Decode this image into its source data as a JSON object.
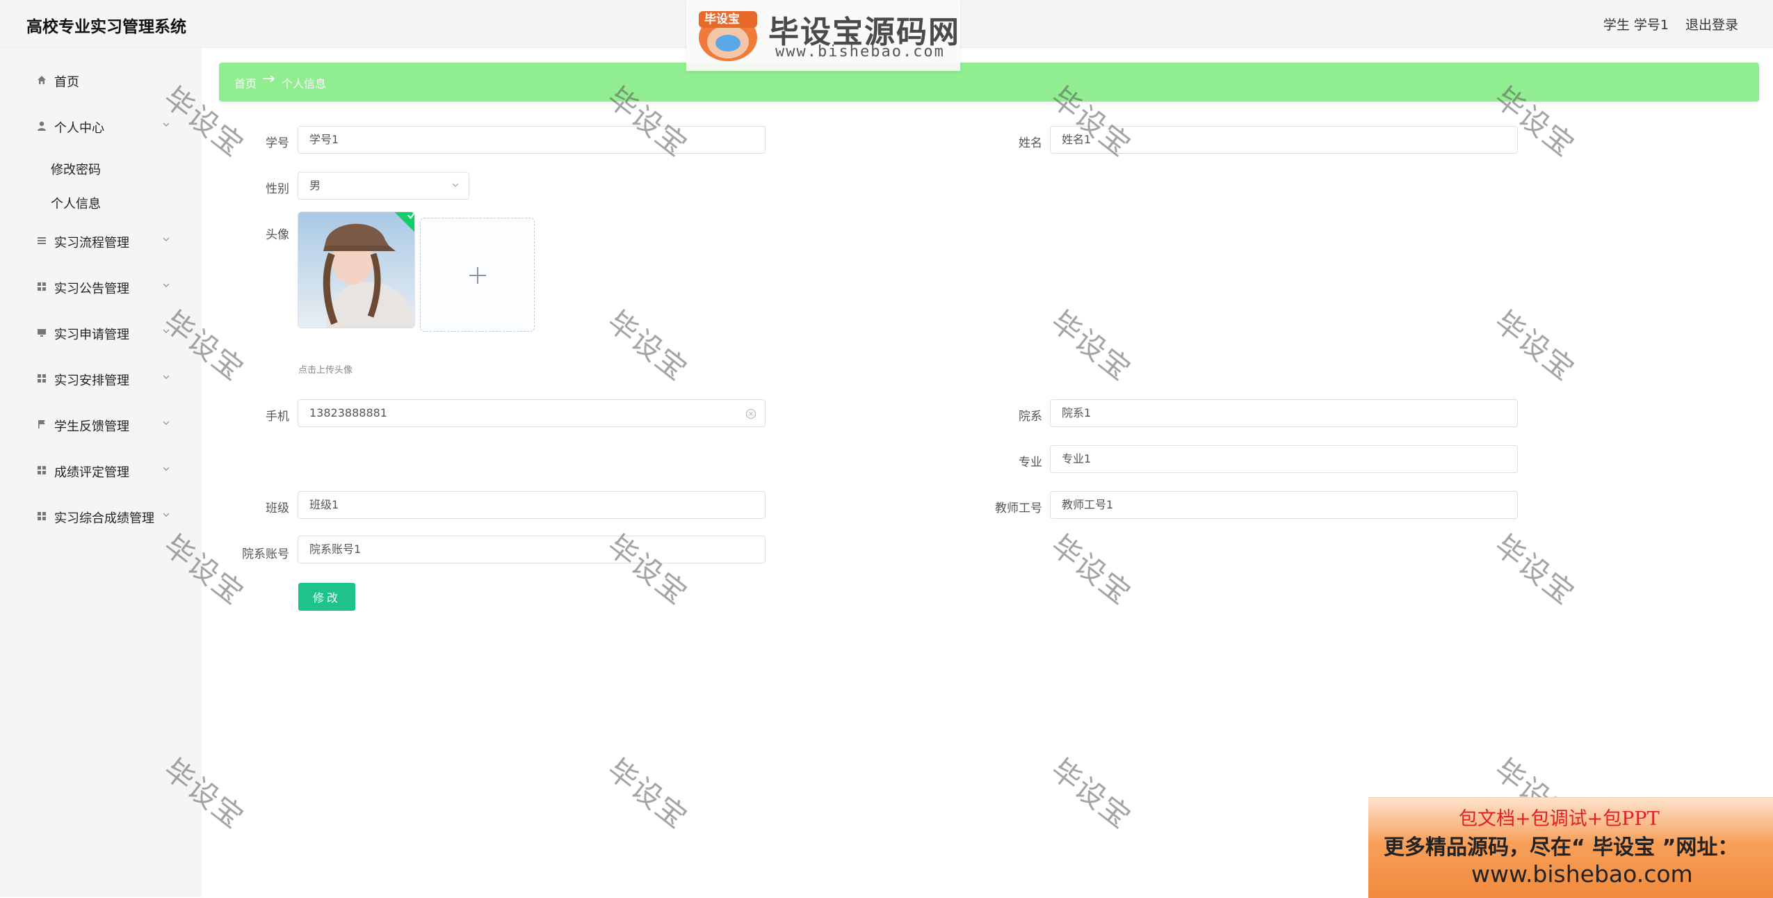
{
  "header": {
    "title": "高校专业实习管理系统",
    "user_label": "学生 学号1",
    "logout_label": "退出登录"
  },
  "watermark_logo": {
    "badge": "毕设宝",
    "title": "毕设宝源码网",
    "url": "www.bishebao.com"
  },
  "watermark_text": "毕设宝",
  "sidebar": {
    "items": [
      {
        "label": "首页",
        "icon": "home-icon"
      },
      {
        "label": "个人中心",
        "icon": "user-icon"
      },
      {
        "label": "实习流程管理",
        "icon": "list-icon"
      },
      {
        "label": "实习公告管理",
        "icon": "grid-icon"
      },
      {
        "label": "实习申请管理",
        "icon": "monitor-icon"
      },
      {
        "label": "实习安排管理",
        "icon": "grid-icon"
      },
      {
        "label": "学生反馈管理",
        "icon": "flag-icon"
      },
      {
        "label": "成绩评定管理",
        "icon": "grid-icon"
      },
      {
        "label": "实习综合成绩管理",
        "icon": "grid-icon"
      }
    ],
    "sub_items": [
      "修改密码",
      "个人信息"
    ]
  },
  "breadcrumb": {
    "home": "首页",
    "separator": "→",
    "current": "个人信息"
  },
  "form": {
    "student_no": {
      "label": "学号",
      "value": "学号1"
    },
    "name": {
      "label": "姓名",
      "value": "姓名1"
    },
    "gender": {
      "label": "性别",
      "value": "男"
    },
    "avatar": {
      "label": "头像",
      "tip": "点击上传头像"
    },
    "phone": {
      "label": "手机",
      "value": "13823888881"
    },
    "department": {
      "label": "院系",
      "value": "院系1"
    },
    "major": {
      "label": "专业",
      "value": "专业1"
    },
    "class": {
      "label": "班级",
      "value": "班级1"
    },
    "teacher_no": {
      "label": "教师工号",
      "value": "教师工号1"
    },
    "dept_account": {
      "label": "院系账号",
      "value": "院系账号1"
    },
    "submit_label": "修改"
  },
  "promo": {
    "line1": "包文档+包调试+包PPT",
    "line2": "更多精品源码，尽在“ 毕设宝 ”网址：",
    "line3": "www.bishebao.com"
  },
  "colors": {
    "breadcrumb_bg": "#90ee90",
    "primary_button": "#1ec38c",
    "sidebar_bg": "#f5f5f7"
  }
}
